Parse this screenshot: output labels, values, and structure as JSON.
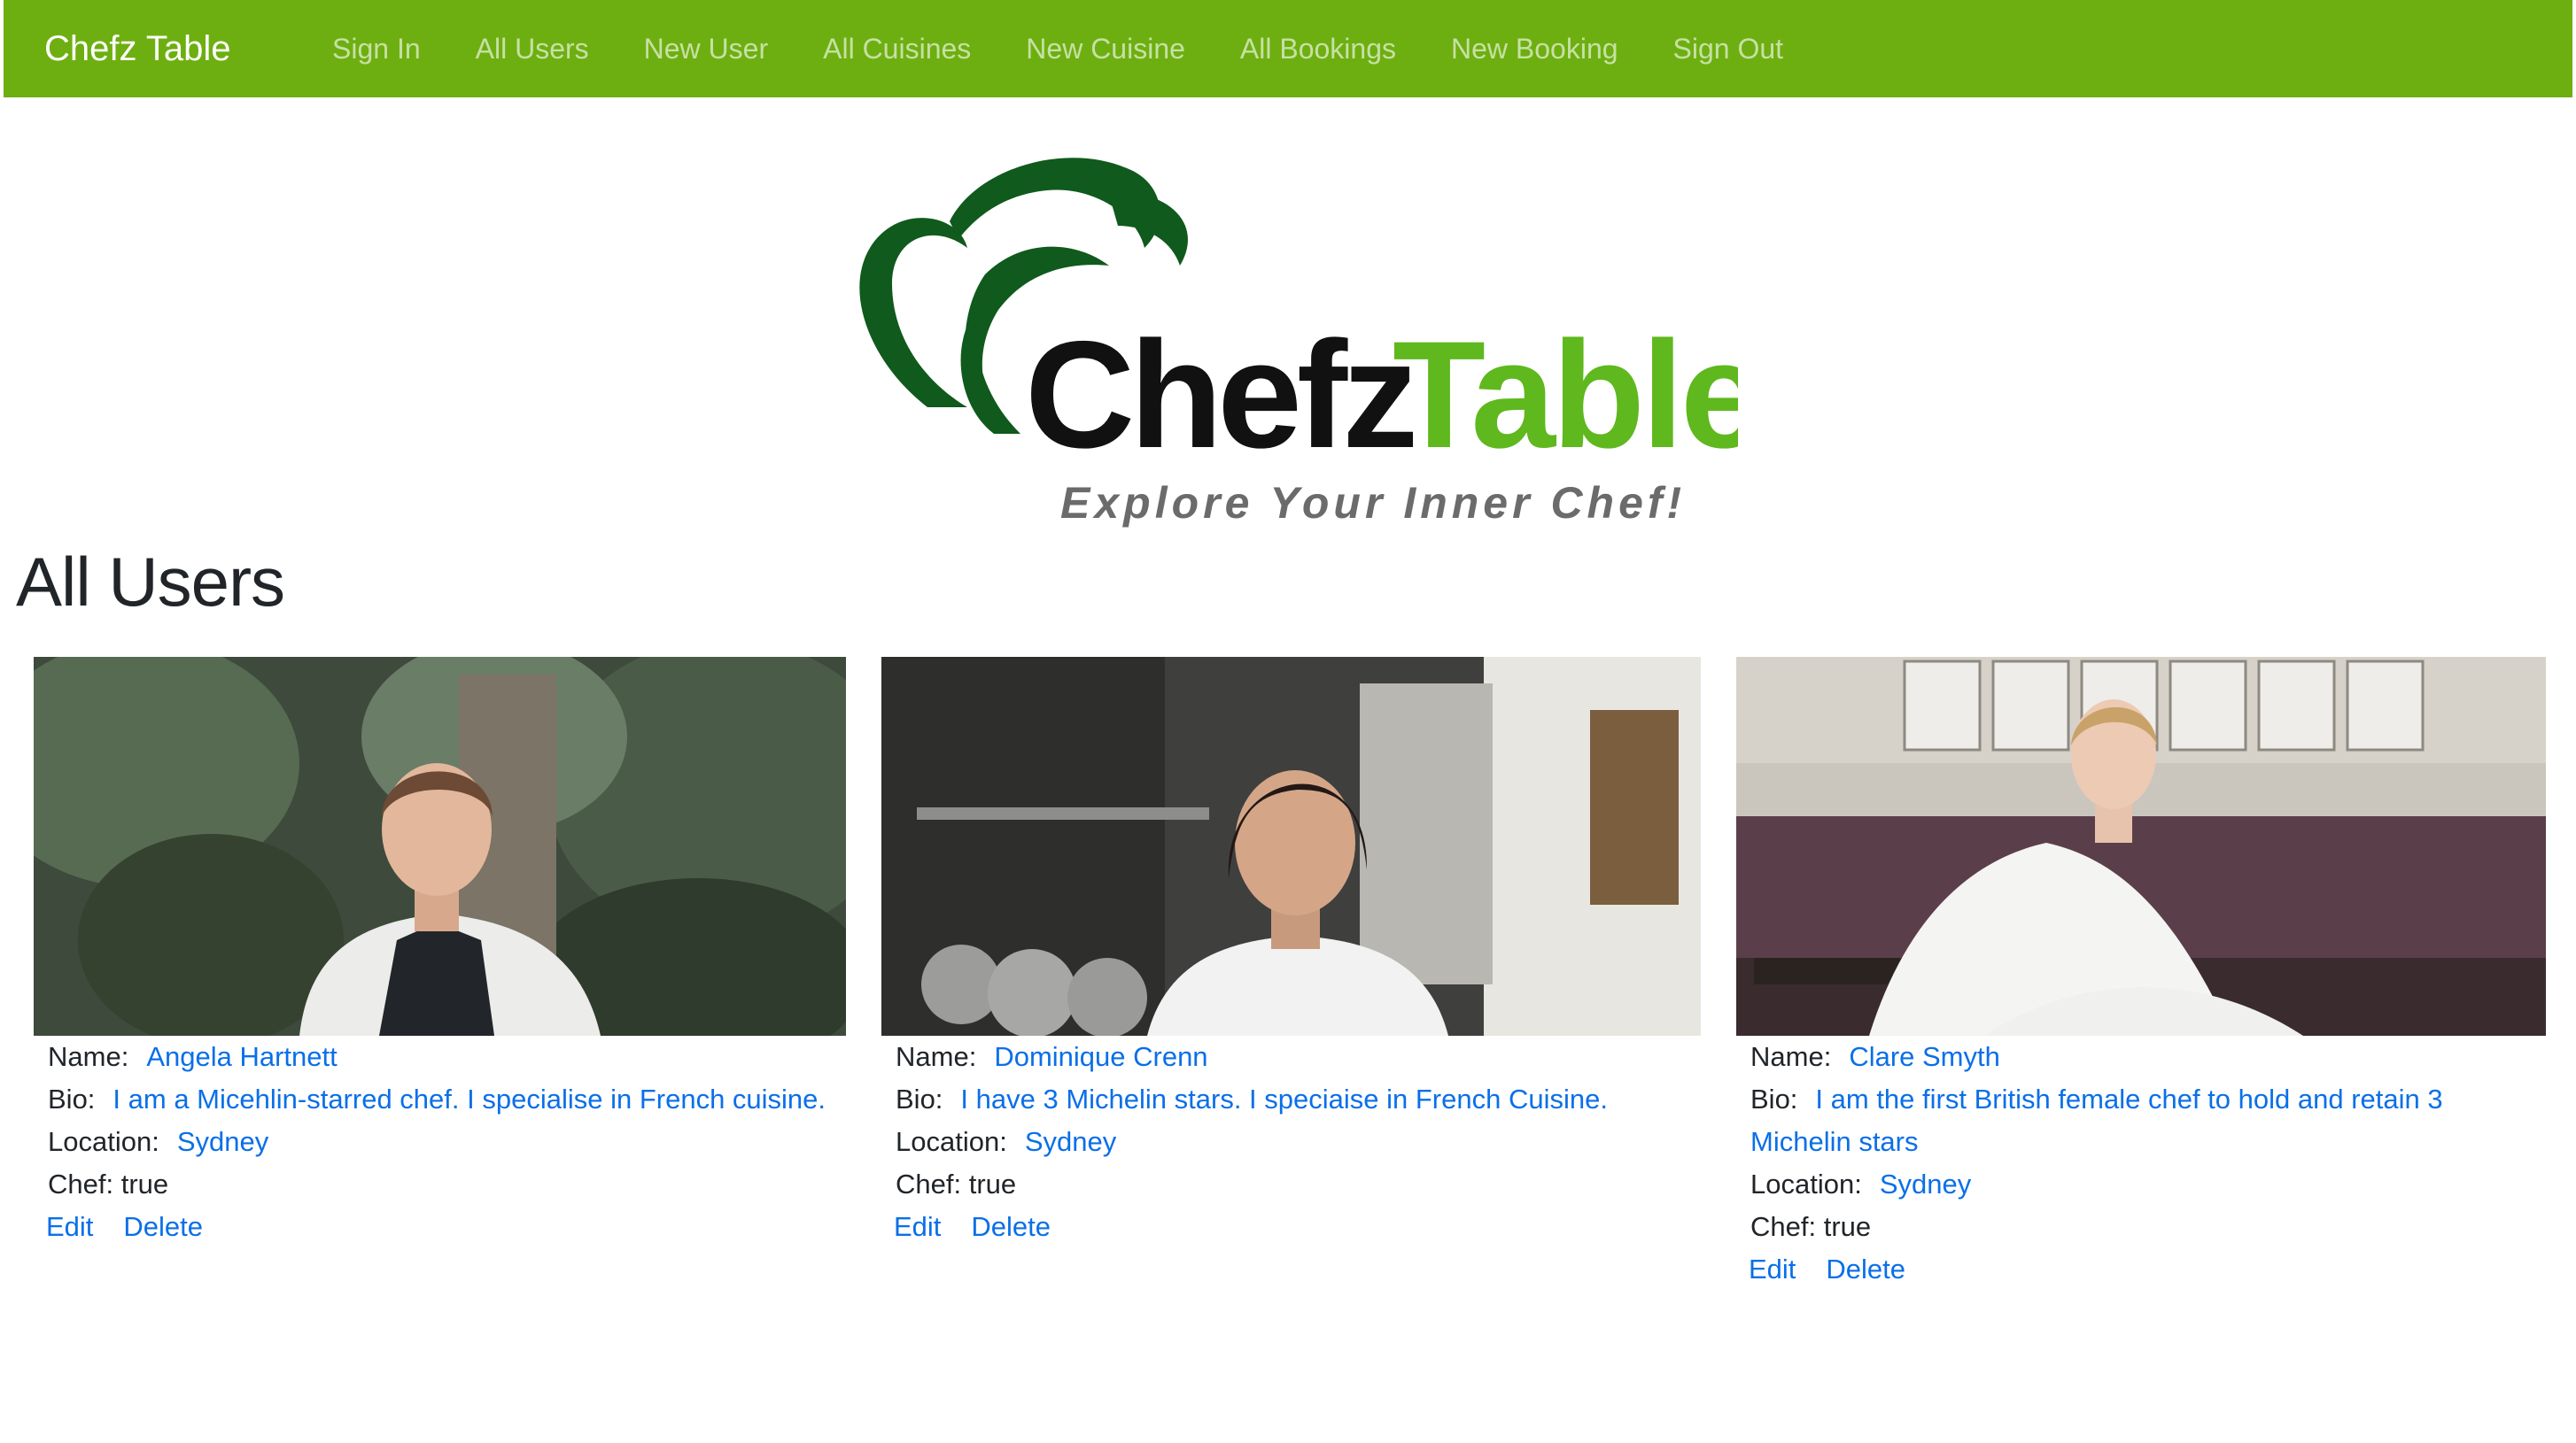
{
  "navbar": {
    "brand": "Chefz Table",
    "links": [
      "Sign In",
      "All Users",
      "New User",
      "All Cuisines",
      "New Cuisine",
      "All Bookings",
      "New Booking",
      "Sign Out"
    ],
    "background_color": "#6daf10"
  },
  "logo": {
    "word1": "Chefz",
    "word2": "Table",
    "tagline": "Explore Your Inner Chef!",
    "dark_green": "#0f5a1c",
    "light_green": "#5fb81e"
  },
  "page": {
    "title": "All Users"
  },
  "labels": {
    "name": "Name:",
    "bio": "Bio:",
    "location": "Location:",
    "chef": "Chef:",
    "edit": "Edit",
    "delete": "Delete"
  },
  "users": [
    {
      "name": "Angela Hartnett",
      "bio": "I am a Micehlin-starred chef. I specialise in French cuisine.",
      "location": "Sydney",
      "chef": "true"
    },
    {
      "name": "Dominique Crenn",
      "bio": "I have 3 Michelin stars. I speciaise in French Cuisine.",
      "location": "Sydney",
      "chef": "true"
    },
    {
      "name": "Clare Smyth",
      "bio": "I am the first British female chef to hold and retain 3 Michelin stars",
      "location": "Sydney",
      "chef": "true"
    }
  ]
}
